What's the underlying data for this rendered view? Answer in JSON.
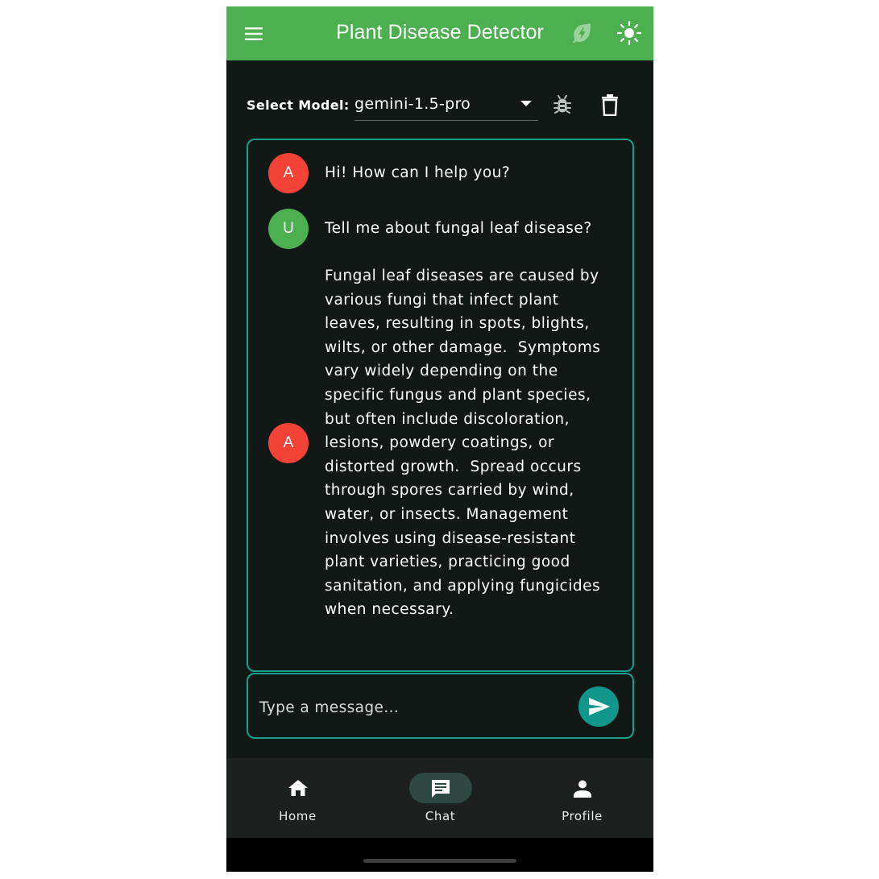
{
  "app_bar": {
    "title": "Plant Disease Detector",
    "menu_icon": "menu-icon",
    "leaf_icon": "eco-leaf-bolt-icon",
    "theme_icon": "sun-icon",
    "color": "#4caf50"
  },
  "model_selector": {
    "label": "Select Model:",
    "selected": "gemini-1.5-pro",
    "debug_icon": "bug-icon",
    "clear_icon": "trash-icon"
  },
  "messages": [
    {
      "sender": "A",
      "role": "assistant",
      "avatar_color": "#f44336",
      "text": "Hi! How can I help you?"
    },
    {
      "sender": "U",
      "role": "user",
      "avatar_color": "#4caf50",
      "text": "Tell me about fungal leaf disease?"
    },
    {
      "sender": "A",
      "role": "assistant",
      "avatar_color": "#f44336",
      "text": "Fungal leaf diseases are caused by various fungi that infect plant leaves, resulting in spots, blights, wilts, or other damage.  Symptoms vary widely depending on the specific fungus and plant species, but often include discoloration, lesions, powdery coatings, or distorted growth.  Spread occurs through spores carried by wind, water, or insects. Management involves using disease-resistant plant varieties, practicing good sanitation, and applying fungicides when necessary."
    }
  ],
  "composer": {
    "placeholder": "Type a message...",
    "send_icon": "send-icon",
    "accent": "#13a08c"
  },
  "bottom_nav": {
    "items": [
      {
        "label": "Home",
        "icon": "home-icon",
        "active": false
      },
      {
        "label": "Chat",
        "icon": "chat-icon",
        "active": true
      },
      {
        "label": "Profile",
        "icon": "person-icon",
        "active": false
      }
    ]
  }
}
